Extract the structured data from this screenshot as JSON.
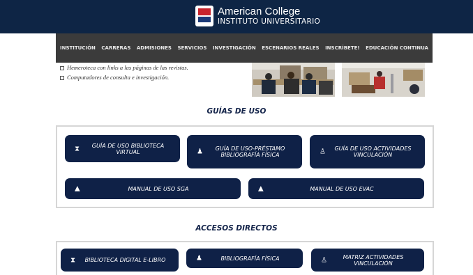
{
  "header": {
    "college_name": "American College",
    "college_subtitle": "INSTITUTO UNIVERSITARIO"
  },
  "nav": {
    "items": [
      "INSTITUCIÓN",
      "CARRERAS",
      "ADMISIONES",
      "SERVICIOS",
      "INVESTIGACIÓN",
      "ESCENARIOS REALES",
      "INSCRÍBETE!",
      "EDUCACIÓN CONTINUA"
    ]
  },
  "library": {
    "bullets": [
      "Hemeroteca con links a las páginas de las revistas.",
      "Computadores de consulta e investigación."
    ]
  },
  "guides": {
    "heading": "GUÍAS DE USO",
    "buttons": [
      {
        "label": "GUÍA DE USO BIBLIOTECA VIRTUAL",
        "icon": "hourglass-icon"
      },
      {
        "label": "GUÍA DE USO-PRÉSTAMO BIBLIOGRAFÍA FÍSICA",
        "icon": "users-icon"
      },
      {
        "label": "GUÍA DE USO ACTIVIDADES VINCULACIÓN",
        "icon": "user-network-icon"
      },
      {
        "label": "MANUAL DE USO SGA",
        "icon": "graduation-cap-icon"
      },
      {
        "label": "MANUAL DE USO EVAC",
        "icon": "graduation-cap-icon"
      }
    ]
  },
  "access": {
    "heading": "ACCESOS DIRECTOS",
    "buttons": [
      {
        "label": "BIBLIOTECA DIGITAL E-LIBRO",
        "icon": "hourglass-icon"
      },
      {
        "label": "BIBLIOGRAFÍA FÍSICA",
        "icon": "users-icon"
      },
      {
        "label": "MATRIZ ACTIVIDADES VINCULACIÓN",
        "icon": "user-network-icon"
      }
    ]
  },
  "colors": {
    "header_bg": "#0e2545",
    "nav_bg": "#3b3b3b",
    "button_bg": "#0f2147",
    "heading_text": "#14244a"
  }
}
